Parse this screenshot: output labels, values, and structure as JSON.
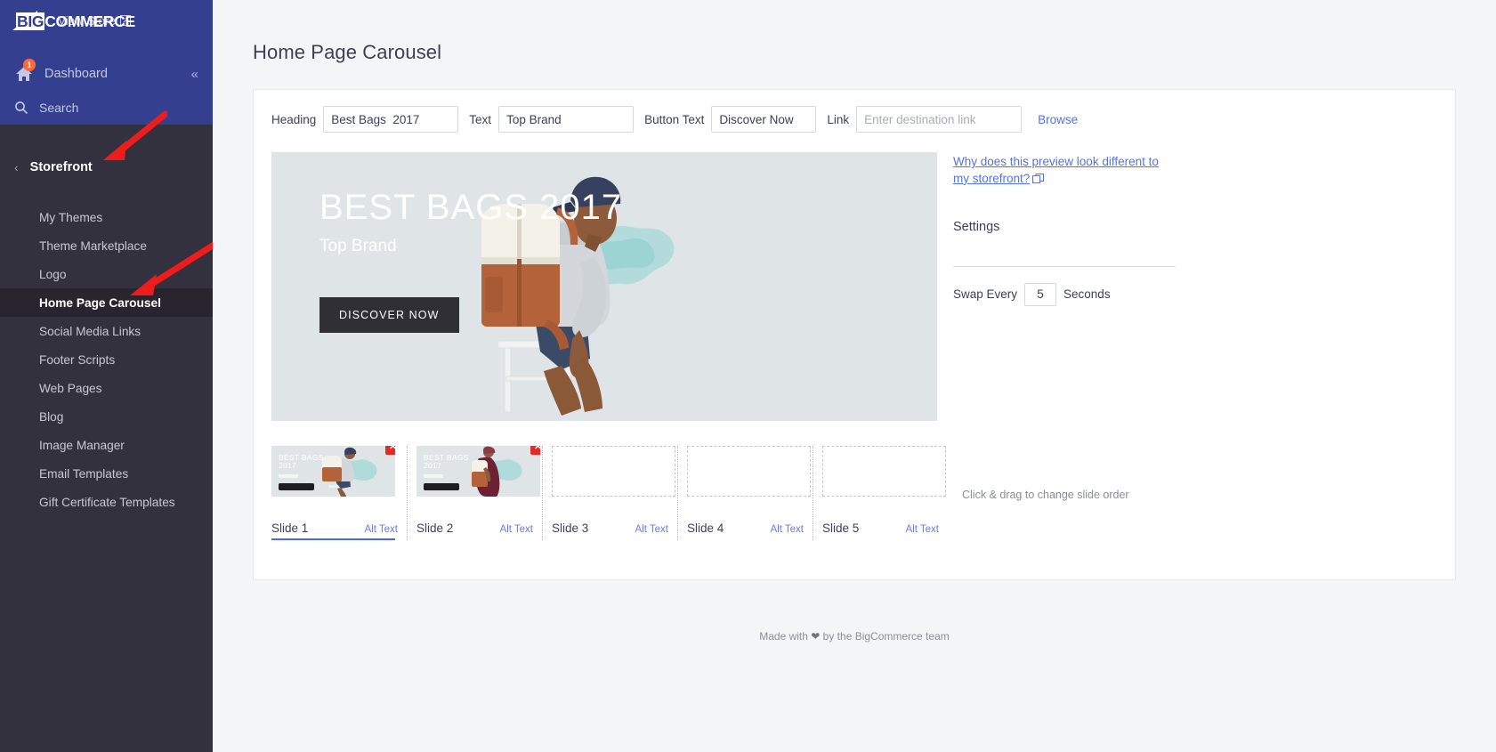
{
  "sidebar": {
    "brand": {
      "big": "BIG",
      "commerce": "COMMERCE",
      "view_store": "View Store"
    },
    "dashboard": {
      "label": "Dashboard",
      "badge": "1"
    },
    "search": {
      "label": "Search"
    },
    "section": {
      "label": "Storefront"
    },
    "items": [
      {
        "label": "My Themes",
        "active": false
      },
      {
        "label": "Theme Marketplace",
        "active": false
      },
      {
        "label": "Logo",
        "active": false
      },
      {
        "label": "Home Page Carousel",
        "active": true
      },
      {
        "label": "Social Media Links",
        "active": false
      },
      {
        "label": "Footer Scripts",
        "active": false
      },
      {
        "label": "Web Pages",
        "active": false
      },
      {
        "label": "Blog",
        "active": false
      },
      {
        "label": "Image Manager",
        "active": false
      },
      {
        "label": "Email Templates",
        "active": false
      },
      {
        "label": "Gift Certificate Templates",
        "active": false
      }
    ]
  },
  "page": {
    "title": "Home Page Carousel"
  },
  "form": {
    "heading_label": "Heading",
    "heading_value": "Best Bags  2017",
    "text_label": "Text",
    "text_value": "Top Brand",
    "button_text_label": "Button Text",
    "button_text_value": "Discover Now",
    "link_label": "Link",
    "link_value": "",
    "link_placeholder": "Enter destination link",
    "browse_label": "Browse"
  },
  "preview": {
    "heading": "BEST BAGS 2017",
    "subheading": "Top Brand",
    "button": "DISCOVER NOW"
  },
  "settings": {
    "why_link": "Why does this preview look different to my storefront?",
    "title": "Settings",
    "swap_label": "Swap Every",
    "swap_value": "5",
    "seconds_label": "Seconds"
  },
  "slides": {
    "items": [
      {
        "name": "Slide 1",
        "alt_text": "Alt Text",
        "filled": true,
        "current": true,
        "thumb_heading": "BEST BAGS\n2017"
      },
      {
        "name": "Slide 2",
        "alt_text": "Alt Text",
        "filled": true,
        "current": false,
        "thumb_heading": "BEST BAGS\n2017"
      },
      {
        "name": "Slide 3",
        "alt_text": "Alt Text",
        "filled": false,
        "current": false,
        "thumb_heading": ""
      },
      {
        "name": "Slide 4",
        "alt_text": "Alt Text",
        "filled": false,
        "current": false,
        "thumb_heading": ""
      },
      {
        "name": "Slide 5",
        "alt_text": "Alt Text",
        "filled": false,
        "current": false,
        "thumb_heading": ""
      }
    ],
    "delete_icon": "✕",
    "drag_hint": "Click & drag to change slide order"
  },
  "footer": {
    "prefix": "Made with ",
    "suffix": " by the BigCommerce team"
  },
  "colors": {
    "sidebar_top": "#353f8f",
    "sidebar_body": "#34313f",
    "sidebar_active": "#28252f",
    "accent_link": "#5773e3",
    "delete_red": "#e02b27",
    "badge_orange": "#ff6a3d",
    "arrow_red": "#ee1c1c"
  }
}
